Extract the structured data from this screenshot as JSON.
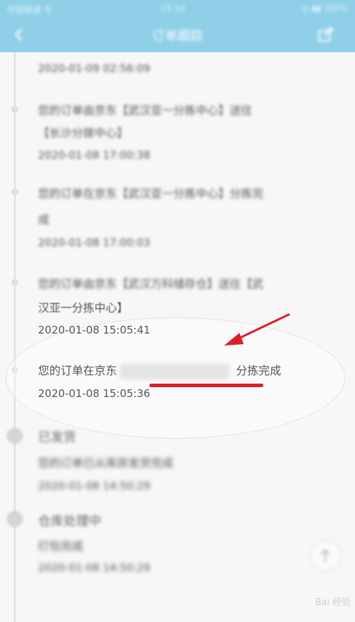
{
  "status_bar": {
    "left": "中国联通 令",
    "center": "15:14",
    "right": "◎ ▮▮ 100%"
  },
  "nav": {
    "title": "订单跟踪"
  },
  "timeline": {
    "entry0": {
      "time": "2020-01-09 02:56:09"
    },
    "entry1": {
      "line1": "您的订单由京东【武汉亚一分拣中心】送往",
      "line2": "【长沙分拨中心】",
      "time": "2020-01-08 17:00:38"
    },
    "entry2": {
      "line1": "您的订单在京东【武汉亚一分拣中心】分拣完",
      "line2": "成",
      "time": "2020-01-08 17:00:03"
    },
    "entry3": {
      "line1": "您的订单由京东【武汉万科储存仓】送往【武",
      "line2": "汉亚一分拣中心】",
      "time": "2020-01-08 15:05:41"
    },
    "entry4": {
      "prefix": "您的订单在京东",
      "suffix": "分拣完成",
      "time": "2020-01-08 15:05:36"
    },
    "shipped": {
      "title": "已发货",
      "desc": "您的订单已从库房发货完成",
      "time": "2020-01-08 14:50:29"
    },
    "processing": {
      "title": "仓库处理中",
      "desc": "打包完成",
      "time": "2020-01-08 14:50:29"
    }
  },
  "watermark": "Bai 经验",
  "colors": {
    "header": "#8fd0e8",
    "annotation": "#d9202a"
  }
}
